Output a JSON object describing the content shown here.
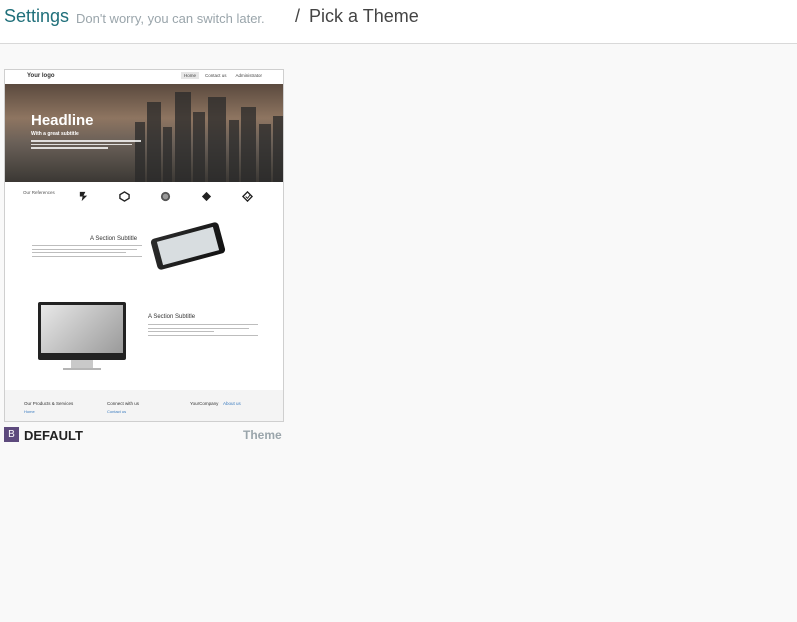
{
  "breadcrumb": {
    "settings": "Settings",
    "hint": "Don't worry, you can switch later.",
    "separator": "/",
    "current": "Pick a Theme"
  },
  "theme_card": {
    "badge": "B",
    "name": "DEFAULT",
    "tag": "Theme",
    "preview": {
      "logo": "Your logo",
      "menu": [
        "Home",
        "Contact us",
        "Administrator"
      ],
      "headline": "Headline",
      "subtitle": "With a great subtitle",
      "references_label": "Our References",
      "section1_title": "A Section Subtitle",
      "section2_title": "A Section Subtitle",
      "footer": {
        "col1_title": "Our Products & Services",
        "col1_link": "Home",
        "col2_title": "Connect with us",
        "col2_link": "Contact us",
        "col3_title": "YourCompany",
        "col3_link": "About us"
      }
    }
  },
  "colors": {
    "accent": "#1f6f7a",
    "badge": "#5d4a7d",
    "muted": "#9aa5ab"
  }
}
